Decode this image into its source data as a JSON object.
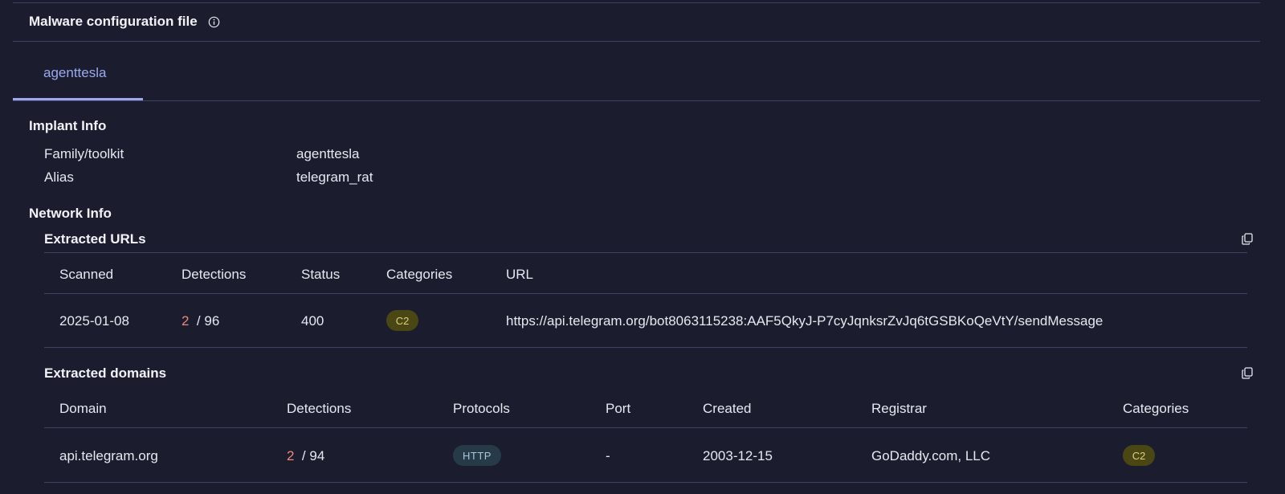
{
  "header": {
    "title": "Malware configuration file"
  },
  "tabs": [
    {
      "label": "agenttesla",
      "active": true
    }
  ],
  "implant_info": {
    "title": "Implant Info",
    "rows": [
      {
        "key": "Family/toolkit",
        "value": "agenttesla"
      },
      {
        "key": "Alias",
        "value": "telegram_rat"
      }
    ]
  },
  "network_info": {
    "title": "Network Info",
    "urls": {
      "title": "Extracted URLs",
      "columns": [
        "Scanned",
        "Detections",
        "Status",
        "Categories",
        "URL"
      ],
      "rows": [
        {
          "scanned": "2025-01-08",
          "detections_positive": "2",
          "detections_total": "/ 96",
          "status": "400",
          "category": "C2",
          "url": "https://api.telegram.org/bot8063115238:AAF5QkyJ-P7cyJqnksrZvJq6tGSBKoQeVtY/sendMessage"
        }
      ]
    },
    "domains": {
      "title": "Extracted domains",
      "columns": [
        "Domain",
        "Detections",
        "Protocols",
        "Port",
        "Created",
        "Registrar",
        "Categories"
      ],
      "rows": [
        {
          "domain": "api.telegram.org",
          "detections_positive": "2",
          "detections_total": "/ 94",
          "protocol": "HTTP",
          "port": "-",
          "created": "2003-12-15",
          "registrar": "GoDaddy.com, LLC",
          "category": "C2"
        }
      ]
    }
  },
  "colors": {
    "background": "#1b1d2f",
    "accent": "#9aa9ee",
    "detection_positive": "#f0857d",
    "badge_c2_bg": "#4a4714",
    "badge_http_bg": "#263a48"
  },
  "icons": {
    "info": "info-icon",
    "copy": "copy-icon"
  }
}
